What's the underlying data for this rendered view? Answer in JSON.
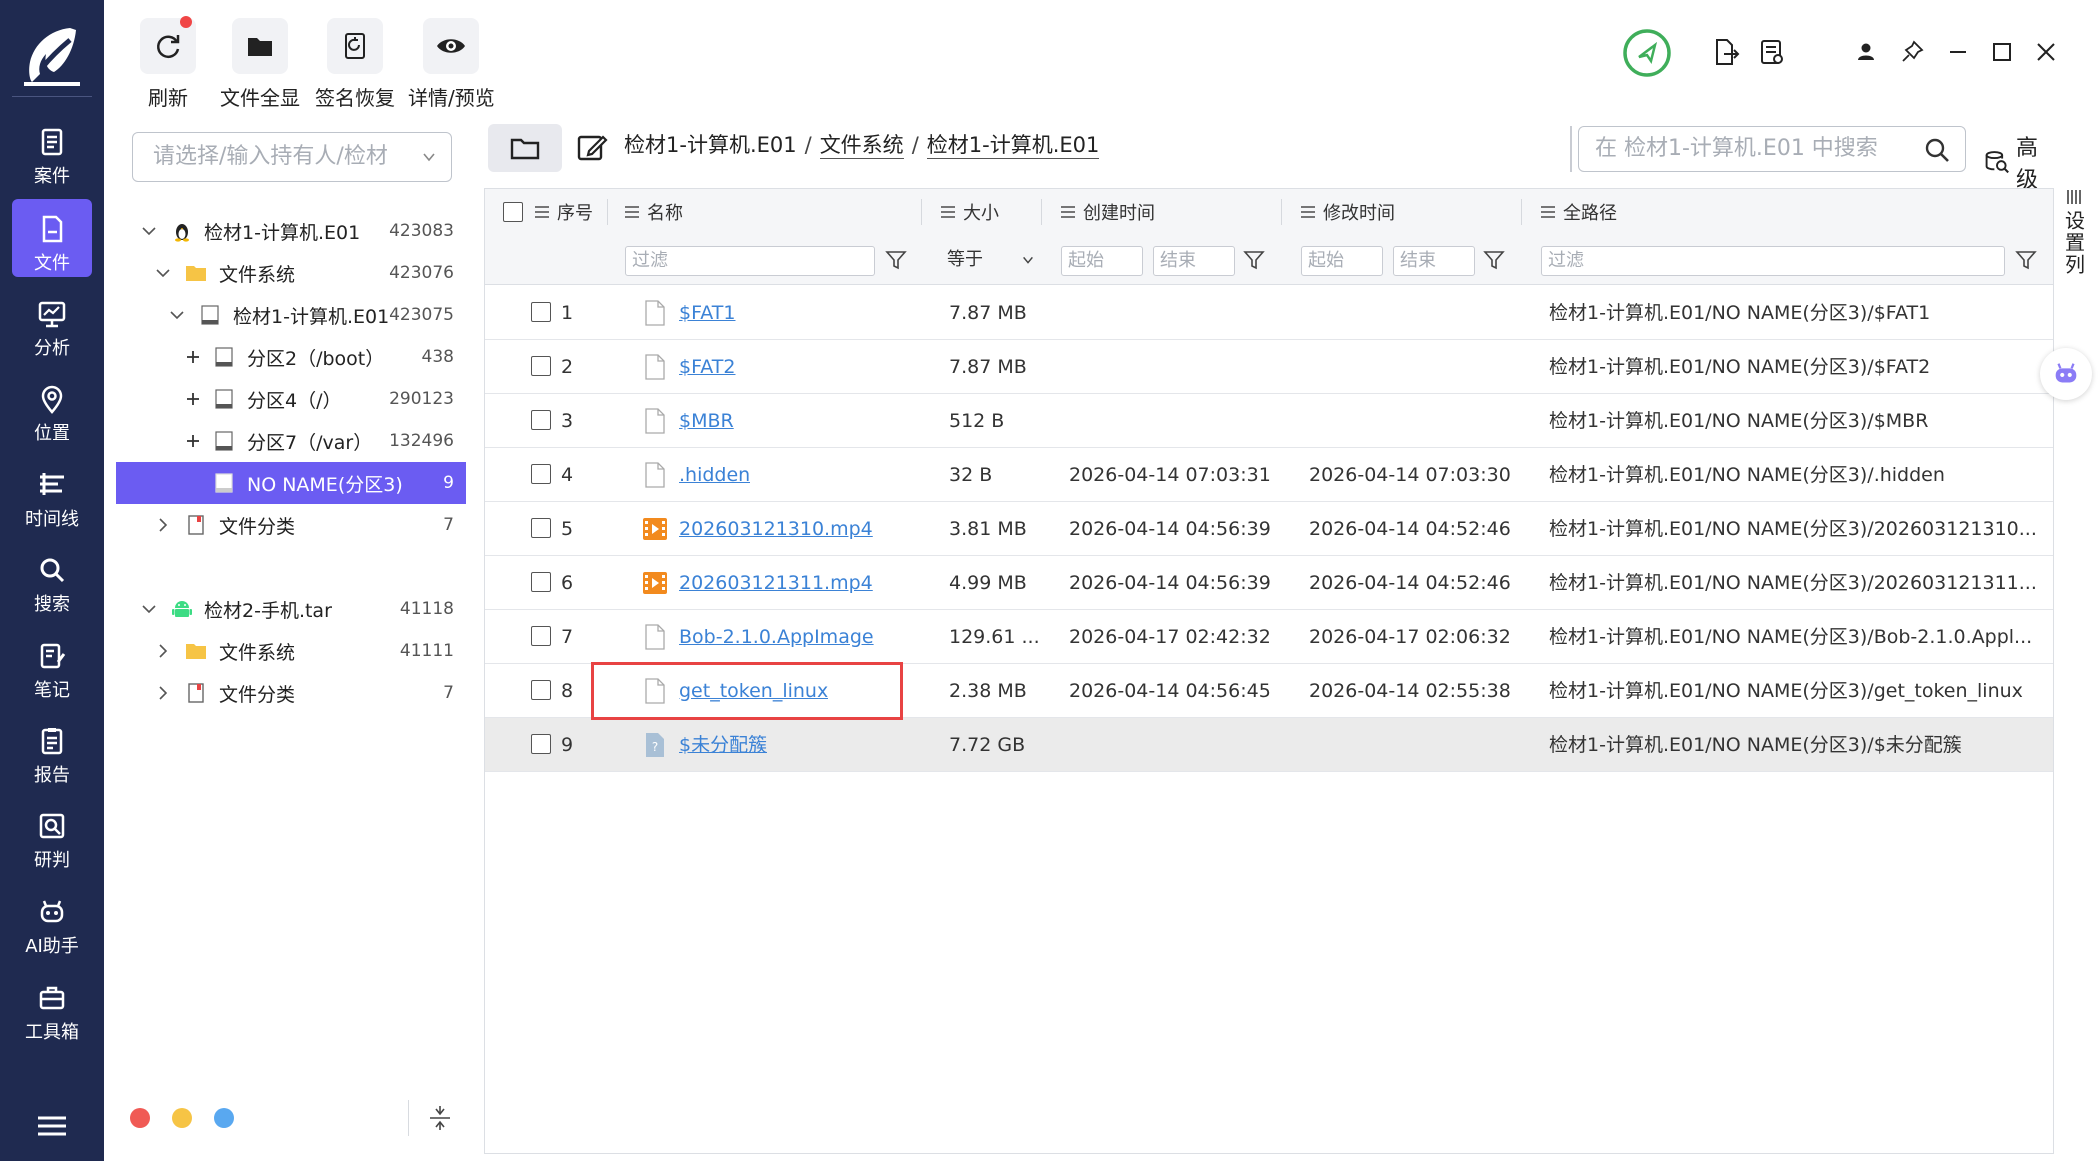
{
  "nav": {
    "items": [
      {
        "label": "案件",
        "icon": "case-icon"
      },
      {
        "label": "文件",
        "icon": "file-icon",
        "active": true
      },
      {
        "label": "分析",
        "icon": "analysis-icon"
      },
      {
        "label": "位置",
        "icon": "location-icon"
      },
      {
        "label": "时间线",
        "icon": "timeline-icon"
      },
      {
        "label": "搜索",
        "icon": "search-icon"
      },
      {
        "label": "笔记",
        "icon": "notes-icon"
      },
      {
        "label": "报告",
        "icon": "report-icon"
      },
      {
        "label": "研判",
        "icon": "judge-icon"
      },
      {
        "label": "AI助手",
        "icon": "robot-icon"
      },
      {
        "label": "工具箱",
        "icon": "toolbox-icon"
      }
    ],
    "accent": "#6b5cf2",
    "background": "#1f2a50"
  },
  "toolbar": {
    "refresh": "刷新",
    "show_all": "文件全显",
    "signature_recover": "签名恢复",
    "detail_preview": "详情/预览"
  },
  "left_panel": {
    "owner_placeholder": "请选择/输入持有人/检材",
    "tree": [
      {
        "label": "检材1-计算机.E01",
        "count": "423083"
      },
      {
        "label": "文件系统",
        "count": "423076"
      },
      {
        "label": "检材1-计算机.E01",
        "count": "423075"
      },
      {
        "label": "分区2（/boot）",
        "count": "438"
      },
      {
        "label": "分区4（/）",
        "count": "290123"
      },
      {
        "label": "分区7（/var）",
        "count": "132496"
      },
      {
        "label": "NO NAME(分区3)",
        "count": "9"
      },
      {
        "label": "文件分类",
        "count": "7"
      },
      {
        "label": "检材2-手机.tar",
        "count": "41118"
      },
      {
        "label": "文件系统",
        "count": "41111"
      },
      {
        "label": "文件分类",
        "count": "7"
      }
    ]
  },
  "main": {
    "breadcrumb": [
      "检材1-计算机.E01",
      "文件系统",
      "检材1-计算机.E01"
    ],
    "search_placeholder": "在 检材1-计算机.E01 中搜索",
    "advanced": "高级",
    "columns": {
      "index": "序号",
      "name": "名称",
      "size": "大小",
      "created": "创建时间",
      "modified": "修改时间",
      "path": "全路径"
    },
    "filters": {
      "name": "过滤",
      "size": "等于",
      "created_start": "起始",
      "created_end": "结束",
      "modified_start": "起始",
      "modified_end": "结束",
      "path": "过滤"
    },
    "rows": [
      {
        "idx": "1",
        "name": "$FAT1",
        "size": "7.87 MB",
        "created": "",
        "modified": "",
        "path": "检材1-计算机.E01/NO NAME(分区3)/$FAT1",
        "type": "file"
      },
      {
        "idx": "2",
        "name": "$FAT2",
        "size": "7.87 MB",
        "created": "",
        "modified": "",
        "path": "检材1-计算机.E01/NO NAME(分区3)/$FAT2",
        "type": "file"
      },
      {
        "idx": "3",
        "name": "$MBR",
        "size": "512 B",
        "created": "",
        "modified": "",
        "path": "检材1-计算机.E01/NO NAME(分区3)/$MBR",
        "type": "file"
      },
      {
        "idx": "4",
        "name": ".hidden",
        "size": "32 B",
        "created": "2026-04-14 07:03:31",
        "modified": "2026-04-14 07:03:30",
        "path": "检材1-计算机.E01/NO NAME(分区3)/.hidden",
        "type": "file"
      },
      {
        "idx": "5",
        "name": "202603121310.mp4",
        "size": "3.81 MB",
        "created": "2026-04-14 04:56:39",
        "modified": "2026-04-14 04:52:46",
        "path": "检材1-计算机.E01/NO NAME(分区3)/202603121310...",
        "type": "video"
      },
      {
        "idx": "6",
        "name": "202603121311.mp4",
        "size": "4.99 MB",
        "created": "2026-04-14 04:56:39",
        "modified": "2026-04-14 04:52:46",
        "path": "检材1-计算机.E01/NO NAME(分区3)/202603121311...",
        "type": "video"
      },
      {
        "idx": "7",
        "name": "Bob-2.1.0.AppImage",
        "size": "129.61 ...",
        "created": "2026-04-17 02:42:32",
        "modified": "2026-04-17 02:06:32",
        "path": "检材1-计算机.E01/NO NAME(分区3)/Bob-2.1.0.Appl...",
        "type": "file"
      },
      {
        "idx": "8",
        "name": "get_token_linux",
        "size": "2.38 MB",
        "created": "2026-04-14 04:56:45",
        "modified": "2026-04-14 02:55:38",
        "path": "检材1-计算机.E01/NO NAME(分区3)/get_token_linux",
        "type": "file"
      },
      {
        "idx": "9",
        "name": "$未分配簇",
        "size": "7.72 GB",
        "created": "",
        "modified": "",
        "path": "检材1-计算机.E01/NO NAME(分区3)/$未分配簇",
        "type": "unknown"
      }
    ],
    "side_settings": "设置列"
  }
}
